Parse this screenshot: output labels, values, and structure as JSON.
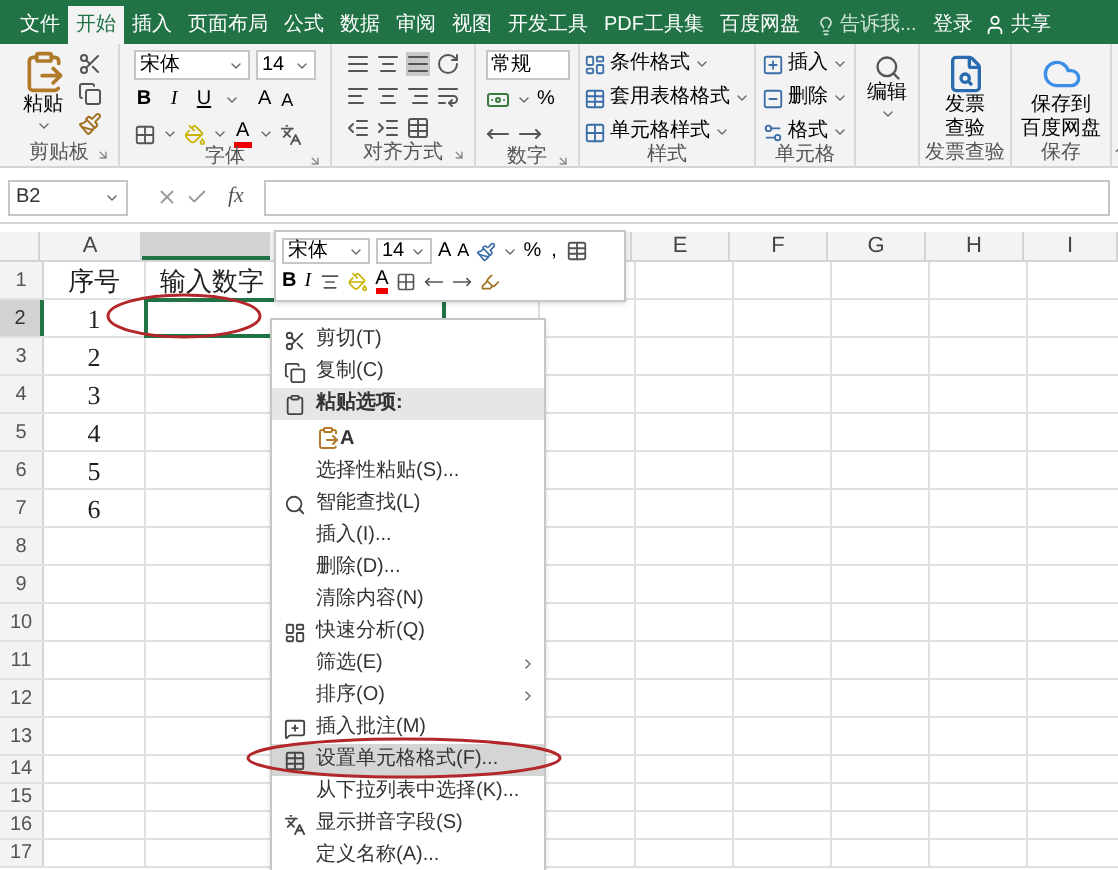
{
  "ribbon_tabs": [
    {
      "label": "文件",
      "selected": false
    },
    {
      "label": "开始",
      "selected": true
    },
    {
      "label": "插入",
      "selected": false
    },
    {
      "label": "页面布局",
      "selected": false
    },
    {
      "label": "公式",
      "selected": false
    },
    {
      "label": "数据",
      "selected": false
    },
    {
      "label": "审阅",
      "selected": false
    },
    {
      "label": "视图",
      "selected": false
    },
    {
      "label": "开发工具",
      "selected": false
    },
    {
      "label": "PDF工具集",
      "selected": false
    },
    {
      "label": "百度网盘",
      "selected": false
    }
  ],
  "tell_me": "告诉我...",
  "sign_in": "登录",
  "share": "共享",
  "ribbon_groups": [
    {
      "kind": "clipboard",
      "label": "剪贴板",
      "launcher": true,
      "paste": "粘贴"
    },
    {
      "kind": "font",
      "label": "字体",
      "launcher": true,
      "font_name": "宋体",
      "font_size": "14",
      "bold": "B",
      "italic": "I",
      "underline": "U",
      "grow": "A",
      "shrink": "A",
      "font_color": "A"
    },
    {
      "kind": "alignment",
      "label": "对齐方式",
      "launcher": true
    },
    {
      "kind": "number",
      "label": "数字",
      "launcher": true,
      "format": "常规",
      "percent": "%"
    },
    {
      "kind": "list",
      "label": "样式",
      "launcher": false,
      "items": [
        "条件格式",
        "套用表格格式",
        "单元格样式"
      ]
    },
    {
      "kind": "list",
      "label": "单元格",
      "launcher": false,
      "items": [
        "插入",
        "删除",
        "格式"
      ]
    },
    {
      "kind": "large",
      "button_lines": [
        "编辑"
      ],
      "dropdown": true
    },
    {
      "kind": "large",
      "label": "发票查验",
      "button_lines": [
        "发票",
        "查验"
      ],
      "dropdown": false
    },
    {
      "kind": "large",
      "label": "保存",
      "button_lines": [
        "保存到",
        "百度网盘"
      ],
      "dropdown": false
    }
  ],
  "formula_bar": {
    "name_box": "B2",
    "function_label": "fx"
  },
  "columns": [
    {
      "label": "A",
      "selected": false
    },
    {
      "selected": true
    },
    {
      "label": "E",
      "selected": false
    },
    {
      "label": "F",
      "selected": false
    },
    {
      "label": "G",
      "selected": false
    },
    {
      "label": "H",
      "selected": false
    },
    {
      "label": "I",
      "selected": false
    }
  ],
  "rows": [
    {
      "label": "1",
      "selected": false,
      "cells": [
        "序号",
        "输入数字"
      ]
    },
    {
      "label": "2",
      "selected": true,
      "cells": [
        "1"
      ]
    },
    {
      "label": "3",
      "selected": false,
      "cells": [
        "2"
      ]
    },
    {
      "label": "4",
      "selected": false,
      "cells": [
        "3"
      ]
    },
    {
      "label": "5",
      "selected": false,
      "cells": [
        "4"
      ]
    },
    {
      "label": "6",
      "selected": false,
      "cells": [
        "5"
      ]
    },
    {
      "label": "7",
      "selected": false,
      "cells": [
        "6"
      ]
    },
    {
      "label": "8",
      "selected": false
    },
    {
      "label": "9",
      "selected": false
    },
    {
      "label": "10",
      "selected": false
    },
    {
      "label": "11",
      "selected": false
    },
    {
      "label": "12",
      "selected": false
    },
    {
      "label": "13",
      "selected": false
    },
    {
      "label": "14",
      "selected": false
    },
    {
      "label": "15",
      "selected": false
    },
    {
      "label": "16",
      "selected": false
    },
    {
      "label": "17",
      "selected": false
    }
  ],
  "mini_toolbar": {
    "font_name": "宋体",
    "font_size": "14",
    "grow": "A",
    "shrink": "A",
    "percent": "%",
    "comma": ",",
    "bold": "B",
    "italic": "I",
    "font_color": "A"
  },
  "context_menu": [
    {
      "kind": "item",
      "label": "剪切(T)",
      "selected": false
    },
    {
      "kind": "item",
      "label": "复制(C)",
      "selected": false
    },
    {
      "kind": "header",
      "label": "粘贴选项:",
      "selected": false
    },
    {
      "kind": "paste_options",
      "label": "A",
      "selected": false
    },
    {
      "kind": "item",
      "label": "选择性粘贴(S)...",
      "selected": false
    },
    {
      "kind": "item",
      "label": "智能查找(L)",
      "selected": false
    },
    {
      "kind": "item",
      "label": "插入(I)...",
      "selected": false
    },
    {
      "kind": "item",
      "label": "删除(D)...",
      "selected": false
    },
    {
      "kind": "item",
      "label": "清除内容(N)",
      "selected": false
    },
    {
      "kind": "item",
      "label": "快速分析(Q)",
      "selected": false
    },
    {
      "kind": "submenu",
      "label": "筛选(E)",
      "selected": false
    },
    {
      "kind": "submenu",
      "label": "排序(O)",
      "selected": false
    },
    {
      "kind": "item",
      "label": "插入批注(M)",
      "selected": false
    },
    {
      "kind": "item",
      "label": "设置单元格格式(F)...",
      "selected": true
    },
    {
      "kind": "item",
      "label": "从下拉列表中选择(K)...",
      "selected": false
    },
    {
      "kind": "item",
      "label": "显示拼音字段(S)",
      "selected": false
    },
    {
      "kind": "item",
      "label": "定义名称(A)...",
      "selected": false
    }
  ]
}
